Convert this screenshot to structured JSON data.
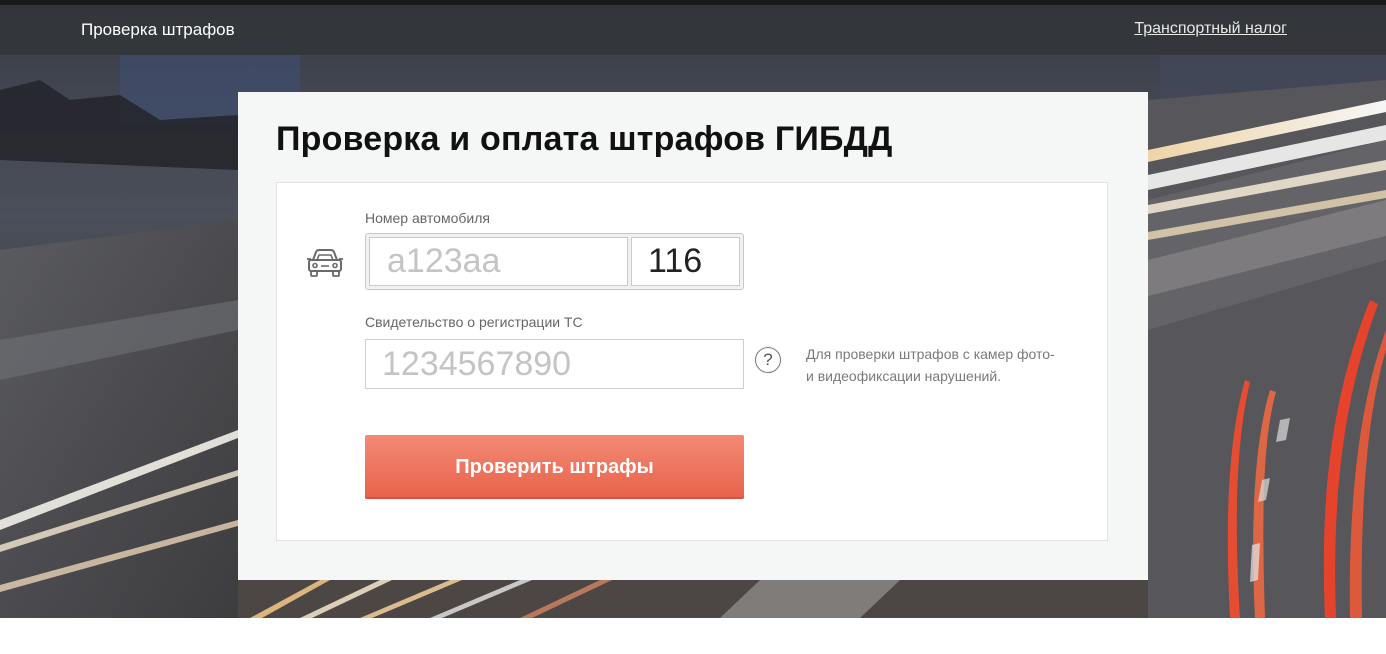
{
  "topbar": {
    "brand": "Проверка штрафов",
    "tax_link": "Транспортный налог"
  },
  "panel": {
    "title": "Проверка и оплата штрафов ГИБДД"
  },
  "form": {
    "car_icon": "car-icon",
    "plate_label": "Номер автомобиля",
    "plate_placeholder": "а123аа",
    "region_value": "116",
    "sts_label": "Свидетельство о регистрации ТС",
    "sts_placeholder": "1234567890",
    "help_icon_glyph": "?",
    "help_text_line1": "Для проверки штрафов с камер фото-",
    "help_text_line2": "и видеофиксации нарушений.",
    "submit_label": "Проверить штрафы"
  },
  "colors": {
    "accent": "#ec6b53",
    "topbar": "#323438",
    "panel": "#f5f6f6"
  }
}
